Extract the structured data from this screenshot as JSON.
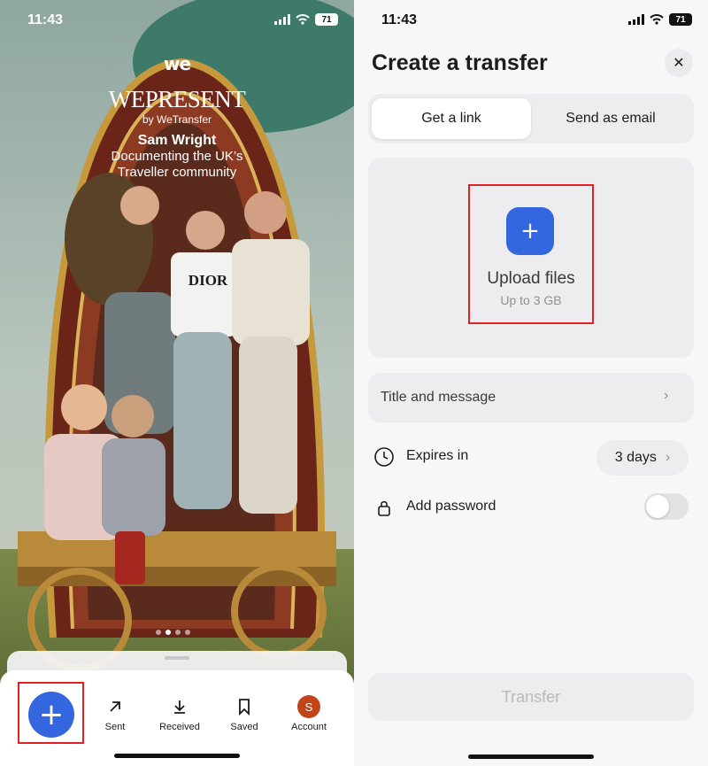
{
  "left_screen": {
    "status": {
      "time": "11:43",
      "battery": "71"
    },
    "brand": {
      "logo_text": "we",
      "title": "WEPRESENT",
      "byline": "by WeTransfer",
      "artist": "Sam Wright",
      "caption_line1": "Documenting the UK’s",
      "caption_line2": "Traveller community"
    },
    "carousel": {
      "page_count": 4,
      "active_index": 1
    },
    "tabbar": {
      "add_icon": "plus-icon",
      "tabs": [
        {
          "label": "Sent",
          "icon": "arrow-up-right-icon"
        },
        {
          "label": "Received",
          "icon": "download-icon"
        },
        {
          "label": "Saved",
          "icon": "bookmark-icon"
        },
        {
          "label": "Account",
          "icon": "avatar",
          "avatar_letter": "S"
        }
      ]
    }
  },
  "right_screen": {
    "status": {
      "time": "11:43",
      "battery": "71"
    },
    "title": "Create a transfer",
    "segments": [
      {
        "label": "Get a link",
        "active": true
      },
      {
        "label": "Send as email",
        "active": false
      }
    ],
    "upload": {
      "title": "Upload files",
      "subtitle": "Up to 3 GB"
    },
    "title_message": "Title and message",
    "expires": {
      "label": "Expires in",
      "value": "3 days"
    },
    "password": {
      "label": "Add password",
      "enabled": false
    },
    "transfer_button": "Transfer"
  },
  "colors": {
    "accent_blue": "#3466e0",
    "highlight_red": "#e0211f",
    "avatar": "#c1441b"
  }
}
